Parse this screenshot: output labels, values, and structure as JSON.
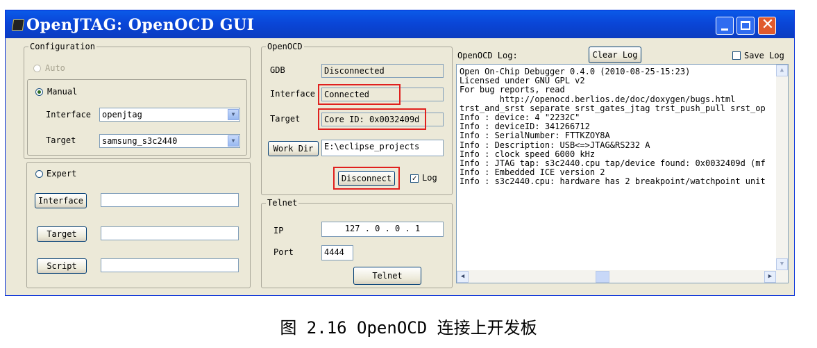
{
  "window": {
    "title": "OpenJTAG: OpenOCD GUI",
    "icon": "app-icon",
    "controls": {
      "minimize": "minimize-icon",
      "maximize": "maximize-icon",
      "close": "close-icon",
      "close_glyph": "✕"
    }
  },
  "configuration": {
    "legend": "Configuration",
    "auto_label": "Auto",
    "manual_label": "Manual",
    "interface_label": "Interface",
    "interface_value": "openjtag",
    "target_label": "Target",
    "target_value": "samsung_s3c2440",
    "expert_label": "Expert",
    "expert_interface_button": "Interface",
    "expert_target_button": "Target",
    "expert_script_button": "Script",
    "expert_interface_value": "",
    "expert_target_value": "",
    "expert_script_value": "",
    "selected_mode": "Manual"
  },
  "openocd": {
    "legend": "OpenOCD",
    "gdb_label": "GDB",
    "gdb_status": "Disconnected",
    "interface_label": "Interface",
    "interface_status": "Connected",
    "target_label": "Target",
    "target_status": "Core ID: 0x0032409d",
    "workdir_button": "Work Dir",
    "workdir_value": "E:\\eclipse_projects",
    "disconnect_button": "Disconnect",
    "log_checkbox_label": "Log",
    "log_checked": true
  },
  "telnet": {
    "legend": "Telnet",
    "ip_label": "IP",
    "ip_value": "127 . 0 . 0 . 1",
    "port_label": "Port",
    "port_value": "4444",
    "telnet_button": "Telnet"
  },
  "log": {
    "label": "OpenOCD Log:",
    "clear_button": "Clear Log",
    "save_label": "Save Log",
    "save_checked": false,
    "text": "Open On-Chip Debugger 0.4.0 (2010-08-25-15:23)\nLicensed under GNU GPL v2\nFor bug reports, read\n        http://openocd.berlios.de/doc/doxygen/bugs.html\ntrst_and_srst separate srst_gates_jtag trst_push_pull srst_op\nInfo : device: 4 \"2232C\"\nInfo : deviceID: 341266712\nInfo : SerialNumber: FTTKZOY8A\nInfo : Description: USB<=>JTAG&RS232 A\nInfo : clock speed 6000 kHz\nInfo : JTAG tap: s3c2440.cpu tap/device found: 0x0032409d (mf\nInfo : Embedded ICE version 2\nInfo : s3c2440.cpu: hardware has 2 breakpoint/watchpoint unit",
    "scroll_up": "▲",
    "scroll_down": "▼",
    "scroll_left": "◀",
    "scroll_right": "▶"
  },
  "caption": "图 2.16 OpenOCD 连接上开发板",
  "colors": {
    "highlight": "#e0201e",
    "titlebar": "#0a46d8"
  }
}
